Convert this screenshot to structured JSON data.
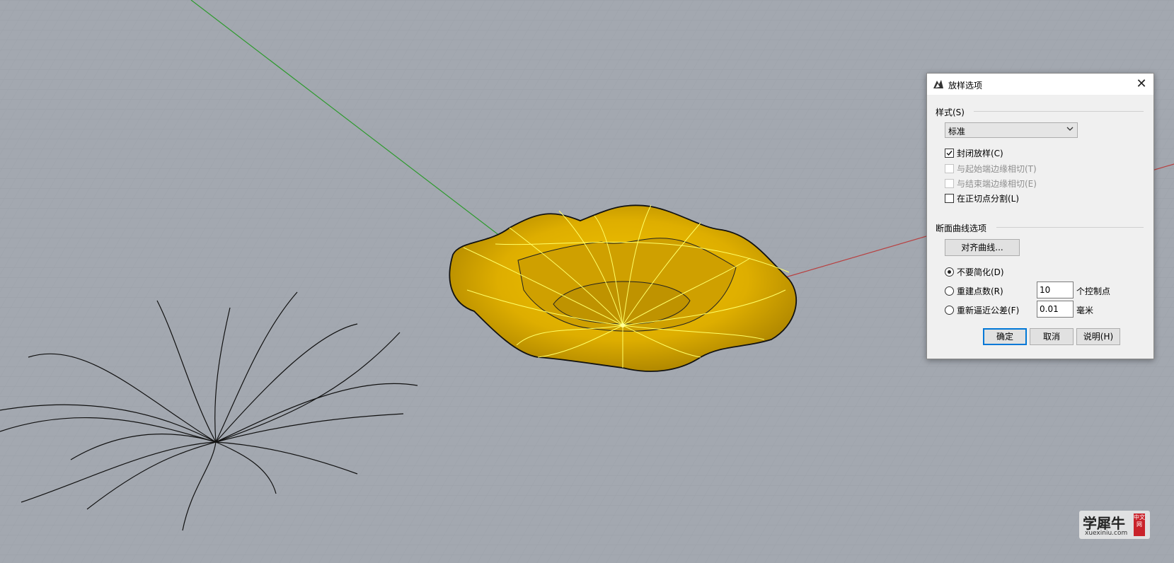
{
  "dialog": {
    "title": "放样选项",
    "close_glyph": "✕",
    "style_group": {
      "label": "样式(S)",
      "selected": "标准"
    },
    "checkboxes": [
      {
        "label": "封闭放样(C)",
        "checked": true,
        "enabled": true
      },
      {
        "label": "与起始端边缘相切(T)",
        "checked": false,
        "enabled": false
      },
      {
        "label": "与结束端边缘相切(E)",
        "checked": false,
        "enabled": false
      },
      {
        "label": "在正切点分割(L)",
        "checked": false,
        "enabled": true
      }
    ],
    "section_group": {
      "label": "断面曲线选项",
      "align_button": "对齐曲线...",
      "radios": [
        {
          "label": "不要简化(D)",
          "selected": true
        },
        {
          "label": "重建点数(R)",
          "selected": false
        },
        {
          "label": "重新逼近公差(F)",
          "selected": false
        }
      ],
      "rebuild_value": "10",
      "rebuild_unit": "个控制点",
      "tolerance_value": "0.01",
      "tolerance_unit": "毫米"
    },
    "buttons": {
      "ok": "确定",
      "cancel": "取消",
      "help": "说明(H)"
    }
  },
  "watermark": {
    "main": "学犀牛",
    "sub": "xuexiniu.com",
    "seal": "中文网"
  },
  "colors": {
    "viewport_bg": "#a3a8b0",
    "grid_line": "#98a0a8",
    "surface": "#e0b000",
    "isocurve": "#ffff66",
    "y_axis": "#2e9a2e",
    "x_axis": "#b84040"
  },
  "icons": {
    "title_icon": "rhino-icon",
    "close": "close-icon",
    "dropdown": "chevron-down-icon"
  }
}
